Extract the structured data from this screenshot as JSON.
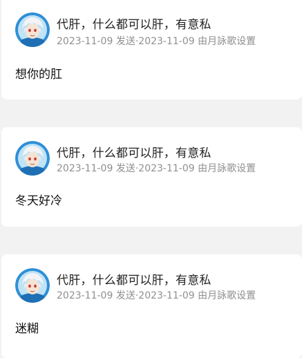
{
  "comments": [
    {
      "author": "代肝，什么都可以肝，有意私",
      "sent_date": "2023-11-09",
      "sent_label": "发送",
      "separator": "·",
      "edited_date": "2023-11-09",
      "edited_label": "由月詠歌设置",
      "text": "想你的肛",
      "avatar_icon": "anime-avatar-icon"
    },
    {
      "author": "代肝，什么都可以肝，有意私",
      "sent_date": "2023-11-09",
      "sent_label": "发送",
      "separator": "·",
      "edited_date": "2023-11-09",
      "edited_label": "由月詠歌设置",
      "text": "冬天好冷",
      "avatar_icon": "anime-avatar-icon"
    },
    {
      "author": "代肝，什么都可以肝，有意私",
      "sent_date": "2023-11-09",
      "sent_label": "发送",
      "separator": "·",
      "edited_date": "2023-11-09",
      "edited_label": "由月詠歌设置",
      "text": "迷糊",
      "avatar_icon": "anime-avatar-icon"
    }
  ],
  "colors": {
    "page_background": "#f2f2f2",
    "card_background": "#ffffff",
    "author_text": "#222222",
    "meta_text": "#8f8f8f",
    "avatar_ring": "#2f8fd6"
  }
}
